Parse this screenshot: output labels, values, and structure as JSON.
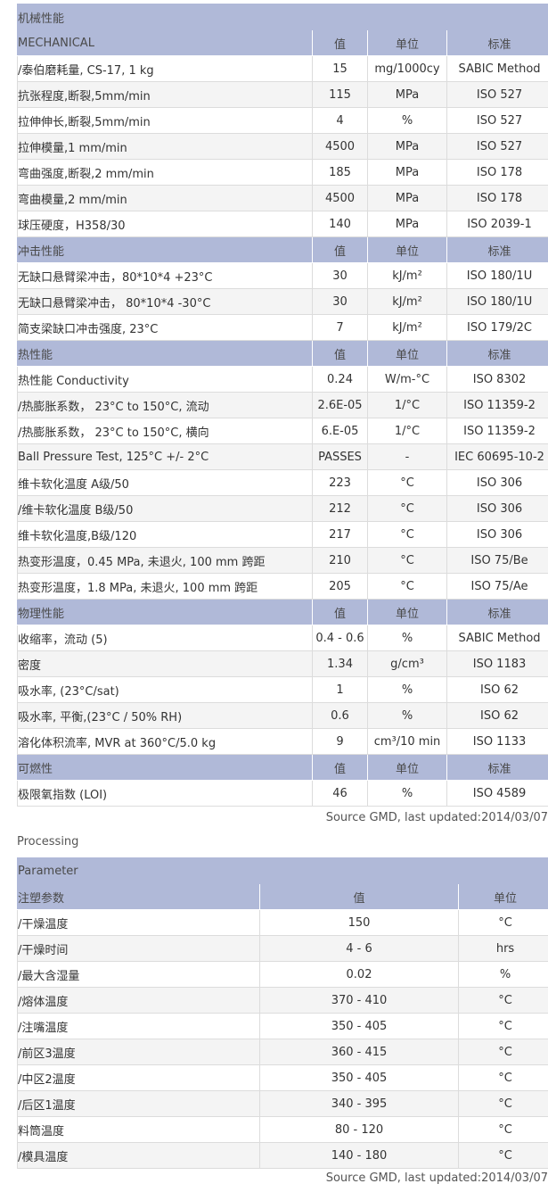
{
  "properties_table": {
    "sections": [
      {
        "title": "机械性能",
        "header": {
          "name": "MECHANICAL",
          "value": "值",
          "unit": "单位",
          "standard": "标准"
        },
        "title_row": true,
        "rows": [
          {
            "name": "/泰伯磨耗量, CS-17, 1 kg",
            "value": "15",
            "unit": "mg/1000cy",
            "standard": "SABIC Method"
          },
          {
            "name": "抗张程度,断裂,5mm/min",
            "value": "115",
            "unit": "MPa",
            "standard": "ISO 527"
          },
          {
            "name": "拉伸伸长,断裂,5mm/min",
            "value": "4",
            "unit": "%",
            "standard": "ISO 527"
          },
          {
            "name": "拉伸模量,1 mm/min",
            "value": "4500",
            "unit": "MPa",
            "standard": "ISO 527"
          },
          {
            "name": "弯曲强度,断裂,2 mm/min",
            "value": "185",
            "unit": "MPa",
            "standard": "ISO 178"
          },
          {
            "name": "弯曲模量,2 mm/min",
            "value": "4500",
            "unit": "MPa",
            "standard": "ISO 178"
          },
          {
            "name": "球压硬度，H358/30",
            "value": "140",
            "unit": "MPa",
            "standard": "ISO 2039-1"
          }
        ]
      },
      {
        "header": {
          "name": "冲击性能",
          "value": "值",
          "unit": "单位",
          "standard": "标准"
        },
        "rows": [
          {
            "name": "无缺口悬臂梁冲击，80*10*4 +23°C",
            "value": "30",
            "unit": "kJ/m²",
            "standard": "ISO 180/1U"
          },
          {
            "name": "无缺口悬臂梁冲击， 80*10*4 -30°C",
            "value": "30",
            "unit": "kJ/m²",
            "standard": "ISO 180/1U"
          },
          {
            "name": "简支梁缺口冲击强度, 23°C",
            "value": "7",
            "unit": "kJ/m²",
            "standard": "ISO 179/2C"
          }
        ]
      },
      {
        "header": {
          "name": "热性能",
          "value": "值",
          "unit": "单位",
          "standard": "标准"
        },
        "rows": [
          {
            "name": "热性能 Conductivity",
            "value": "0.24",
            "unit": "W/m-°C",
            "standard": "ISO 8302"
          },
          {
            "name": "/热膨胀系数， 23°C to 150°C, 流动",
            "value": "2.6E-05",
            "unit": "1/°C",
            "standard": "ISO 11359-2"
          },
          {
            "name": "/热膨胀系数， 23°C to 150°C, 横向",
            "value": "6.E-05",
            "unit": "1/°C",
            "standard": "ISO 11359-2"
          },
          {
            "name": "Ball Pressure Test, 125°C +/- 2°C",
            "value": "PASSES",
            "unit": "-",
            "standard": "IEC 60695-10-2"
          },
          {
            "name": "维卡软化温度 A级/50",
            "value": "223",
            "unit": "°C",
            "standard": "ISO 306"
          },
          {
            "name": "/维卡软化温度 B级/50",
            "value": "212",
            "unit": "°C",
            "standard": "ISO 306"
          },
          {
            "name": "维卡软化温度,B级/120",
            "value": "217",
            "unit": "°C",
            "standard": "ISO 306"
          },
          {
            "name": "热变形温度，0.45 MPa, 未退火, 100 mm 跨距",
            "value": "210",
            "unit": "°C",
            "standard": "ISO 75/Be"
          },
          {
            "name": "热变形温度，1.8 MPa, 未退火, 100 mm 跨距",
            "value": "205",
            "unit": "°C",
            "standard": "ISO 75/Ae"
          }
        ]
      },
      {
        "header": {
          "name": "物理性能",
          "value": "值",
          "unit": "单位",
          "standard": "标准"
        },
        "rows": [
          {
            "name": "收缩率，流动 (5)",
            "value": "0.4 - 0.6",
            "unit": "%",
            "standard": "SABIC Method"
          },
          {
            "name": "密度",
            "value": "1.34",
            "unit": "g/cm³",
            "standard": "ISO 1183"
          },
          {
            "name": "吸水率, (23°C/sat)",
            "value": "1",
            "unit": "%",
            "standard": "ISO 62"
          },
          {
            "name": "吸水率, 平衡,(23°C / 50% RH)",
            "value": "0.6",
            "unit": "%",
            "standard": "ISO 62"
          },
          {
            "name": "溶化体积流率, MVR at 360°C/5.0 kg",
            "value": "9",
            "unit": "cm³/10 min",
            "standard": "ISO 1133"
          }
        ]
      },
      {
        "header": {
          "name": "可燃性",
          "value": "值",
          "unit": "单位",
          "standard": "标准"
        },
        "rows": [
          {
            "name": "极限氧指数 (LOI)",
            "value": "46",
            "unit": "%",
            "standard": "ISO 4589"
          }
        ]
      }
    ],
    "source": "Source GMD, last updated:2014/03/07"
  },
  "processing": {
    "label": "Processing",
    "title": "Parameter",
    "header": {
      "name": "注塑参数",
      "value": "值",
      "unit": "单位"
    },
    "rows": [
      {
        "name": "/干燥温度",
        "value": "150",
        "unit": "°C"
      },
      {
        "name": "/干燥时间",
        "value": "4 - 6",
        "unit": "hrs"
      },
      {
        "name": "/最大含湿量",
        "value": "0.02",
        "unit": "%"
      },
      {
        "name": "/熔体温度",
        "value": "370 - 410",
        "unit": "°C"
      },
      {
        "name": "/注嘴温度",
        "value": "350 - 405",
        "unit": "°C"
      },
      {
        "name": "/前区3温度",
        "value": "360 - 415",
        "unit": "°C"
      },
      {
        "name": "/中区2温度",
        "value": "350 - 405",
        "unit": "°C"
      },
      {
        "name": "/后区1温度",
        "value": "340 - 395",
        "unit": "°C"
      },
      {
        "name": "料筒温度",
        "value": "80 - 120",
        "unit": "°C"
      },
      {
        "name": "/模具温度",
        "value": "140 - 180",
        "unit": "°C"
      }
    ],
    "source": "Source GMD, last updated:2014/03/07"
  }
}
